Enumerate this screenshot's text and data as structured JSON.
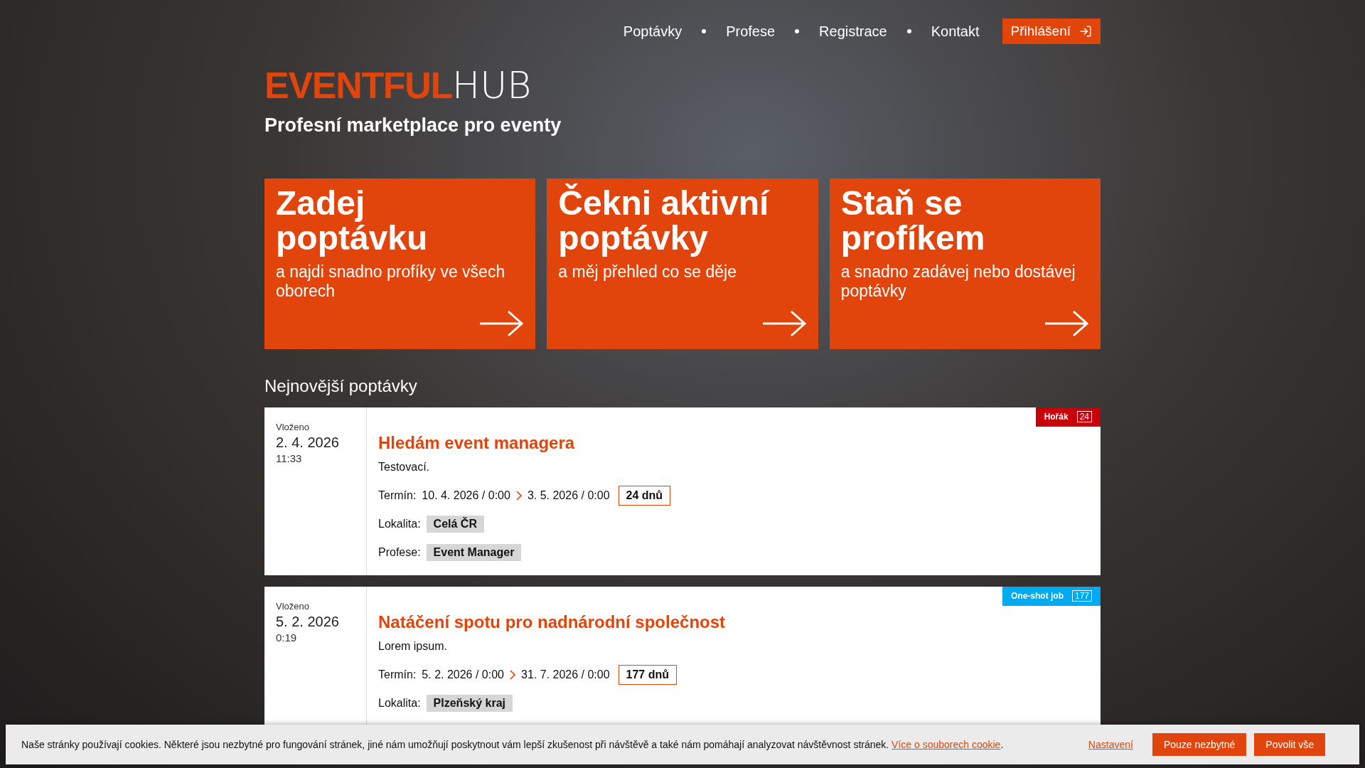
{
  "nav": {
    "items": [
      "Poptávky",
      "Profese",
      "Registrace",
      "Kontakt"
    ],
    "login": "Přihlášení"
  },
  "logo": {
    "bold": "EVENTFUL",
    "light": "HUB"
  },
  "tagline": "Profesní marketplace pro eventy",
  "promos": [
    {
      "title": "Zadej poptávku",
      "subtitle": "a najdi snadno profíky ve všech oborech"
    },
    {
      "title": "Čekni aktivní poptávky",
      "subtitle": "a měj přehled co se děje"
    },
    {
      "title": "Staň se profíkem",
      "subtitle": "a snadno zadávej nebo dostávej poptávky"
    }
  ],
  "section_title": "Nejnovější poptávky",
  "listings": [
    {
      "posted_label": "Vloženo",
      "date": "2. 4. 2026",
      "time": "11:33",
      "badge": {
        "label": "Hořák",
        "count": "24",
        "color": "#c8000a"
      },
      "title": "Hledám event managera",
      "description": "Testovací.",
      "term_label": "Termín:",
      "start": "10. 4. 2026 / 0:00",
      "end": "3. 5. 2026 / 0:00",
      "duration": "24 dnů",
      "location_label": "Lokalita:",
      "locations": [
        "Celá ČR"
      ],
      "profession_label": "Profese:",
      "professions": [
        "Event Manager"
      ]
    },
    {
      "posted_label": "Vloženo",
      "date": "5. 2. 2026",
      "time": "0:19",
      "badge": {
        "label": "One-shot job",
        "count": "177",
        "color": "#00aaf0"
      },
      "title": "Natáčení spotu pro nadnárodní společnost",
      "description": "Lorem ipsum.",
      "term_label": "Termín:",
      "start": "5. 2. 2026 / 0:00",
      "end": "31. 7. 2026 / 0:00",
      "duration": "177 dnů",
      "location_label": "Lokalita:",
      "locations": [
        "Plzeňský kraj"
      ]
    }
  ],
  "cookie_bar": {
    "text": "Naše stránky používají cookies. Některé jsou nezbytné pro fungování stránek, jiné nám umožňují poskytnout vám lepší zkušenost při návštěvě a také nám pomáhají analyzovat návštěvnost stránek.",
    "link": "Více o souborech cookie",
    "link_suffix": ".",
    "settings": "Nastavení",
    "necessary": "Pouze nezbytné",
    "allow_all": "Povolit vše"
  }
}
